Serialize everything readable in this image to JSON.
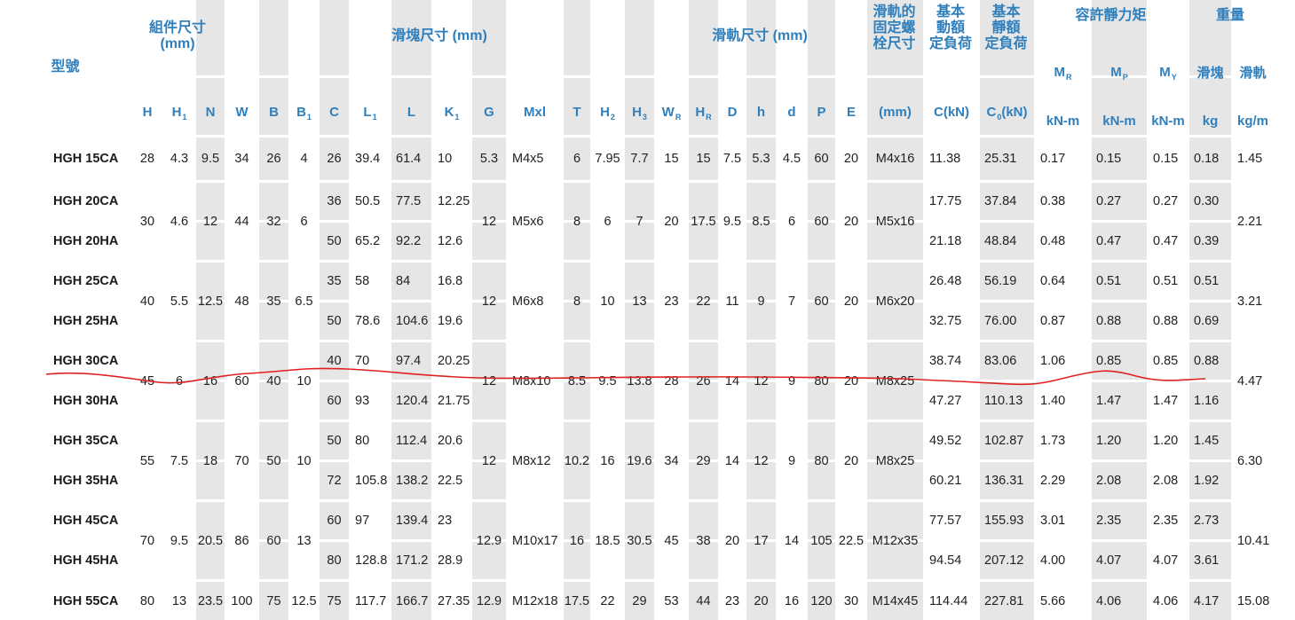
{
  "header": {
    "model": "型號",
    "assembly": "組件尺寸\n(mm)",
    "block": "滑塊尺寸 (mm)",
    "rail": "滑軌尺寸 (mm)",
    "bolt": "滑軌的\n固定螺\n栓尺寸",
    "dynamic": "基本\n動額\n定負荷",
    "static": "基本\n靜額\n定負荷",
    "moment": "容許靜力矩",
    "weight": "重量"
  },
  "columns": [
    {
      "main": "H"
    },
    {
      "main": "H",
      "sub": "1"
    },
    {
      "main": "N"
    },
    {
      "main": "W"
    },
    {
      "main": "B"
    },
    {
      "main": "B",
      "sub": "1"
    },
    {
      "main": "C"
    },
    {
      "main": "L",
      "sub": "1"
    },
    {
      "main": "L"
    },
    {
      "main": "K",
      "sub": "1"
    },
    {
      "main": "G"
    },
    {
      "main": "Mxl"
    },
    {
      "main": "T"
    },
    {
      "main": "H",
      "sub": "2"
    },
    {
      "main": "H",
      "sub": "3"
    },
    {
      "main": "W",
      "sub": "R"
    },
    {
      "main": "H",
      "sub": "R"
    },
    {
      "main": "D"
    },
    {
      "main": "h"
    },
    {
      "main": "d"
    },
    {
      "main": "P"
    },
    {
      "main": "E"
    },
    {
      "main": "(mm)"
    },
    {
      "main": "C(kN)"
    },
    {
      "main": "C",
      "sub": "0",
      "suffix": "(kN)"
    },
    {
      "main": "M",
      "sub": "R",
      "unit": "kN-m"
    },
    {
      "main": "M",
      "sub": "P",
      "unit": "kN-m"
    },
    {
      "main": "M",
      "sub": "Y",
      "unit": "kN-m"
    },
    {
      "main": "滑塊",
      "unit": "kg"
    },
    {
      "main": "滑軌",
      "unit": "kg/m"
    }
  ],
  "rows": [
    {
      "model": "HGH 15CA",
      "v": [
        "28",
        "4.3",
        "9.5",
        "34",
        "26",
        "4",
        "26",
        "39.4",
        "61.4",
        "10",
        "5.3",
        "M4x5",
        "6",
        "7.95",
        "7.7",
        "15",
        "15",
        "7.5",
        "5.3",
        "4.5",
        "60",
        "20",
        "M4x16",
        "11.38",
        "25.31",
        "0.17",
        "0.15",
        "0.15",
        "0.18",
        "1.45"
      ]
    },
    {
      "model": "HGH 20CA",
      "v": [
        "30",
        "4.6",
        "12",
        "44",
        "32",
        "6",
        "36",
        "50.5",
        "77.5",
        "12.25",
        "12",
        "M5x6",
        "8",
        "6",
        "7",
        "20",
        "17.5",
        "9.5",
        "8.5",
        "6",
        "60",
        "20",
        "M5x16",
        "17.75",
        "37.84",
        "0.38",
        "0.27",
        "0.27",
        "0.30",
        "2.21"
      ]
    },
    {
      "model": "HGH 20HA",
      "v": [
        null,
        null,
        null,
        null,
        null,
        null,
        "50",
        "65.2",
        "92.2",
        "12.6",
        null,
        null,
        null,
        null,
        null,
        null,
        null,
        null,
        null,
        null,
        null,
        null,
        null,
        "21.18",
        "48.84",
        "0.48",
        "0.47",
        "0.47",
        "0.39",
        null
      ]
    },
    {
      "model": "HGH 25CA",
      "v": [
        "40",
        "5.5",
        "12.5",
        "48",
        "35",
        "6.5",
        "35",
        "58",
        "84",
        "16.8",
        "12",
        "M6x8",
        "8",
        "10",
        "13",
        "23",
        "22",
        "11",
        "9",
        "7",
        "60",
        "20",
        "M6x20",
        "26.48",
        "56.19",
        "0.64",
        "0.51",
        "0.51",
        "0.51",
        "3.21"
      ]
    },
    {
      "model": "HGH 25HA",
      "v": [
        null,
        null,
        null,
        null,
        null,
        null,
        "50",
        "78.6",
        "104.6",
        "19.6",
        null,
        null,
        null,
        null,
        null,
        null,
        null,
        null,
        null,
        null,
        null,
        null,
        null,
        "32.75",
        "76.00",
        "0.87",
        "0.88",
        "0.88",
        "0.69",
        null
      ]
    },
    {
      "model": "HGH 30CA",
      "v": [
        "45",
        "6",
        "16",
        "60",
        "40",
        "10",
        "40",
        "70",
        "97.4",
        "20.25",
        "12",
        "M8x10",
        "8.5",
        "9.5",
        "13.8",
        "28",
        "26",
        "14",
        "12",
        "9",
        "80",
        "20",
        "M8x25",
        "38.74",
        "83.06",
        "1.06",
        "0.85",
        "0.85",
        "0.88",
        "4.47"
      ]
    },
    {
      "model": "HGH 30HA",
      "v": [
        null,
        null,
        null,
        null,
        null,
        null,
        "60",
        "93",
        "120.4",
        "21.75",
        null,
        null,
        null,
        null,
        null,
        null,
        null,
        null,
        null,
        null,
        null,
        null,
        null,
        "47.27",
        "110.13",
        "1.40",
        "1.47",
        "1.47",
        "1.16",
        null
      ]
    },
    {
      "model": "HGH 35CA",
      "v": [
        "55",
        "7.5",
        "18",
        "70",
        "50",
        "10",
        "50",
        "80",
        "112.4",
        "20.6",
        "12",
        "M8x12",
        "10.2",
        "16",
        "19.6",
        "34",
        "29",
        "14",
        "12",
        "9",
        "80",
        "20",
        "M8x25",
        "49.52",
        "102.87",
        "1.73",
        "1.20",
        "1.20",
        "1.45",
        "6.30"
      ]
    },
    {
      "model": "HGH 35HA",
      "v": [
        null,
        null,
        null,
        null,
        null,
        null,
        "72",
        "105.8",
        "138.2",
        "22.5",
        null,
        null,
        null,
        null,
        null,
        null,
        null,
        null,
        null,
        null,
        null,
        null,
        null,
        "60.21",
        "136.31",
        "2.29",
        "2.08",
        "2.08",
        "1.92",
        null
      ]
    },
    {
      "model": "HGH 45CA",
      "v": [
        "70",
        "9.5",
        "20.5",
        "86",
        "60",
        "13",
        "60",
        "97",
        "139.4",
        "23",
        "12.9",
        "M10x17",
        "16",
        "18.5",
        "30.5",
        "45",
        "38",
        "20",
        "17",
        "14",
        "105",
        "22.5",
        "M12x35",
        "77.57",
        "155.93",
        "3.01",
        "2.35",
        "2.35",
        "2.73",
        "10.41"
      ]
    },
    {
      "model": "HGH 45HA",
      "v": [
        null,
        null,
        null,
        null,
        null,
        null,
        "80",
        "128.8",
        "171.2",
        "28.9",
        null,
        null,
        null,
        null,
        null,
        null,
        null,
        null,
        null,
        null,
        null,
        null,
        null,
        "94.54",
        "207.12",
        "4.00",
        "4.07",
        "4.07",
        "3.61",
        null
      ]
    },
    {
      "model": "HGH 55CA",
      "v": [
        "80",
        "13",
        "23.5",
        "100",
        "75",
        "12.5",
        "75",
        "117.7",
        "166.7",
        "27.35",
        "12.9",
        "M12x18",
        "17.5",
        "22",
        "29",
        "53",
        "44",
        "23",
        "20",
        "16",
        "120",
        "30",
        "M14x45",
        "114.44",
        "227.81",
        "5.66",
        "4.06",
        "4.06",
        "4.17",
        "15.08"
      ]
    }
  ],
  "colors": {
    "header_blue": "#2f7fbd",
    "band_gray": "#e6e6e6",
    "page_bg": "#ffffff",
    "annotation_red": "#e02020"
  },
  "annotation": {
    "type": "hand-drawn red line across row HGH 30CA"
  }
}
